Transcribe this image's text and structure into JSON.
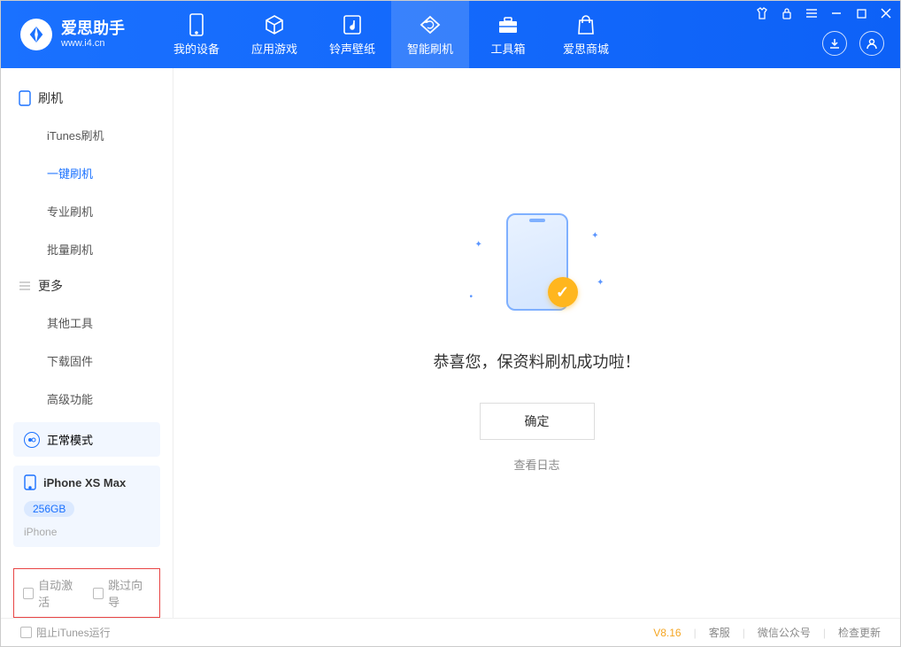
{
  "brand": {
    "name": "爱思助手",
    "url": "www.i4.cn"
  },
  "nav": [
    {
      "label": "我的设备"
    },
    {
      "label": "应用游戏"
    },
    {
      "label": "铃声壁纸"
    },
    {
      "label": "智能刷机"
    },
    {
      "label": "工具箱"
    },
    {
      "label": "爱思商城"
    }
  ],
  "sidebar": {
    "section1": {
      "title": "刷机",
      "items": [
        "iTunes刷机",
        "一键刷机",
        "专业刷机",
        "批量刷机"
      ]
    },
    "section2": {
      "title": "更多",
      "items": [
        "其他工具",
        "下载固件",
        "高级功能"
      ]
    }
  },
  "device": {
    "mode": "正常模式",
    "name": "iPhone XS Max",
    "storage": "256GB",
    "type": "iPhone"
  },
  "checkboxes": {
    "auto_activate": "自动激活",
    "skip_guide": "跳过向导"
  },
  "main": {
    "success": "恭喜您，保资料刷机成功啦！",
    "ok": "确定",
    "log": "查看日志"
  },
  "footer": {
    "block_itunes": "阻止iTunes运行",
    "version": "V8.16",
    "links": [
      "客服",
      "微信公众号",
      "检查更新"
    ]
  }
}
